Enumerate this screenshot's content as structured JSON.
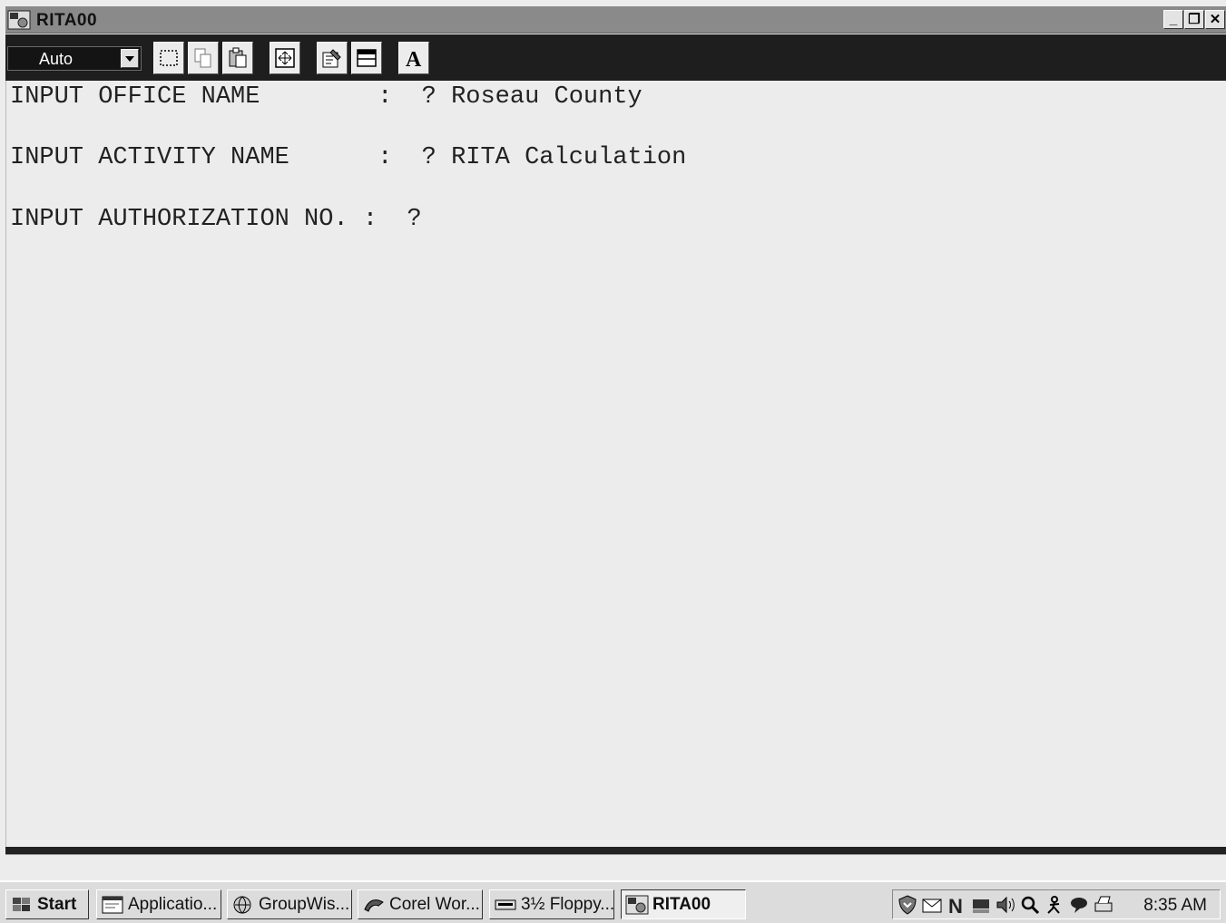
{
  "window": {
    "title": "RITA00",
    "buttons": {
      "minimize": "_",
      "restore": "❐",
      "close": "✕"
    }
  },
  "toolbar": {
    "font_size_select": "Auto",
    "buttons": [
      "mark-icon",
      "copy-icon",
      "paste-icon",
      "full-screen-icon",
      "properties-icon",
      "background-icon",
      "font-icon"
    ]
  },
  "terminal": {
    "lines": [
      "INPUT OFFICE NAME        :  ? Roseau County",
      "INPUT ACTIVITY NAME      :  ? RITA Calculation",
      "INPUT AUTHORIZATION NO. :  ?"
    ]
  },
  "taskbar": {
    "start_label": "Start",
    "tasks": [
      {
        "label": "Applicatio...",
        "icon": "application-icon"
      },
      {
        "label": "GroupWis...",
        "icon": "groupwise-icon"
      },
      {
        "label": "Corel Wor...",
        "icon": "corel-icon"
      },
      {
        "label": "3½ Floppy...",
        "icon": "floppy-icon"
      },
      {
        "label": "RITA00",
        "icon": "msdos-icon",
        "active": true
      }
    ],
    "tray_icons": [
      "shield-icon",
      "mail-icon",
      "netware-icon",
      "network-icon",
      "volume-icon",
      "search-icon",
      "person-icon",
      "chat-icon",
      "printer-icon"
    ],
    "clock": "8:35 AM"
  },
  "colors": {
    "title_bar": "#8a8a8a",
    "toolbar": "#1e1e1e",
    "terminal_bg": "#ececec",
    "taskbar": "#dcdcdc"
  }
}
